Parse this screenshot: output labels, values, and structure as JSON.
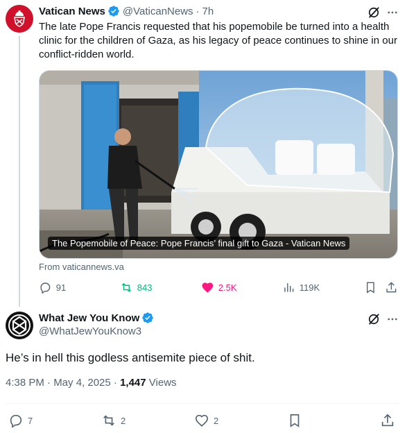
{
  "parent_tweet": {
    "display_name": "Vatican News",
    "handle": "@VaticanNews",
    "separator": "·",
    "time_ago": "7h",
    "text": "The late Pope Francis requested that his popemobile be turned into a health clinic for the children of Gaza, as his legacy of peace continues to shine in our conflict-ridden world.",
    "media_caption": "The Popemobile of Peace: Pope Francis’ final gift to Gaza - Vatican News",
    "source": "From vaticannews.va",
    "stats": {
      "replies": "91",
      "reposts": "843",
      "likes": "2.5K",
      "views": "119K"
    },
    "colors": {
      "repost": "#00ba7c",
      "like": "#f91880",
      "avatar": "#d0112b"
    }
  },
  "reply_tweet": {
    "display_name": "What Jew You Know",
    "handle": "@WhatJewYouKnow3",
    "text": "He’s in hell this godless antisemite piece of shit.",
    "timestamp": "4:38 PM · May 4, 2025 · ",
    "view_count": "1,447",
    "views_label": " Views",
    "stats": {
      "replies": "7",
      "reposts": "2",
      "likes": "2"
    }
  },
  "colors": {
    "text": "#0f1419",
    "muted": "#536471",
    "verified": "#1d9bf0"
  }
}
